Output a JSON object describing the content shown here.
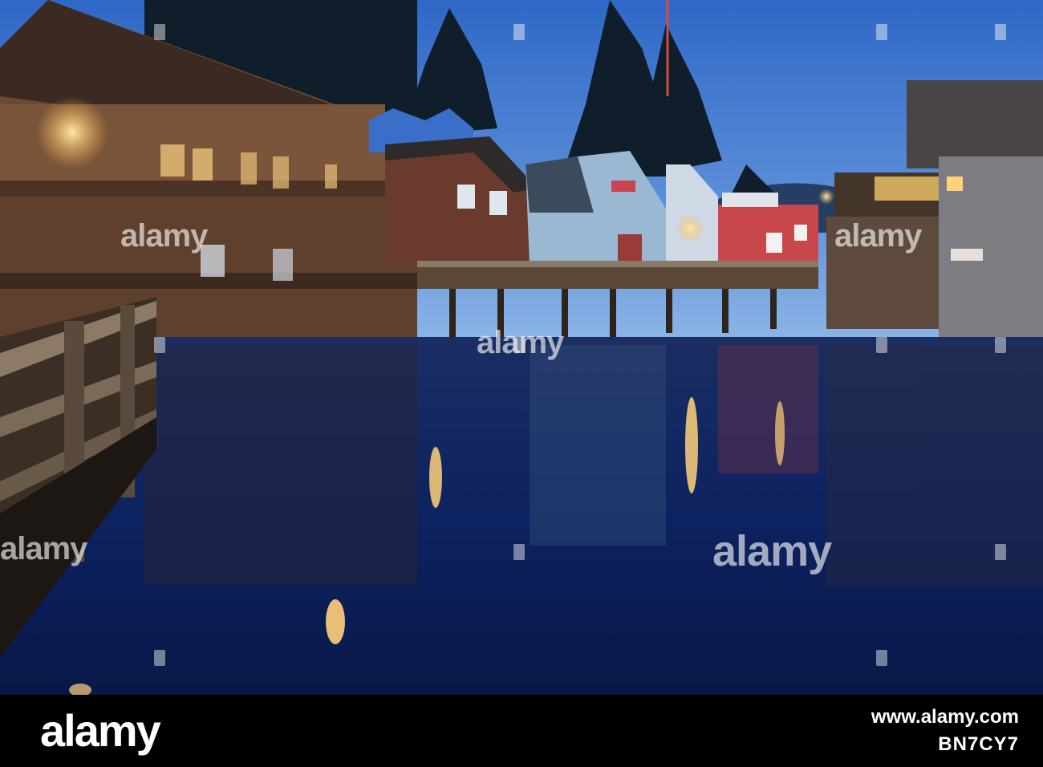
{
  "photo": {
    "scene": "creek-boardwalk-dusk",
    "colors": {
      "sky": "#5c8fd8",
      "water": "#0b1f5a",
      "wood": "#6b4a33",
      "light": "#ffd27a",
      "red_building": "#c8474a"
    }
  },
  "watermark": {
    "text": "alamy"
  },
  "footer": {
    "logo": "alamy",
    "site": "www.alamy.com",
    "image_id": "BN7CY7"
  }
}
